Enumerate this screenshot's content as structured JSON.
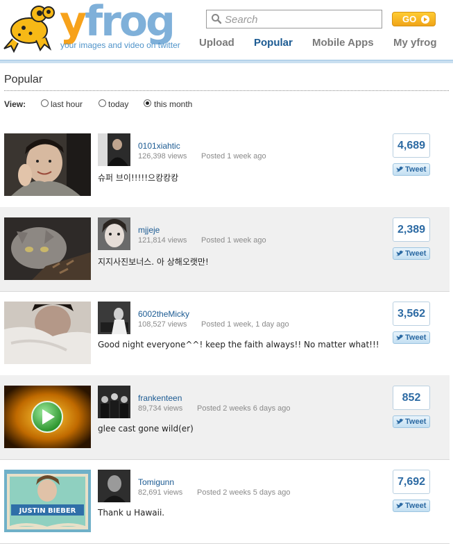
{
  "header": {
    "logo_part1": "y",
    "logo_part2": "frog",
    "tagline": "your images and video on twitter",
    "search_placeholder": "Search",
    "go_label": "GO",
    "nav": [
      {
        "label": "Upload",
        "active": false
      },
      {
        "label": "Popular",
        "active": true
      },
      {
        "label": "Mobile Apps",
        "active": false
      },
      {
        "label": "My yfrog",
        "active": false
      }
    ]
  },
  "section": {
    "title": "Popular",
    "view_label": "View:",
    "view_options": [
      {
        "label": "last hour",
        "selected": false
      },
      {
        "label": "today",
        "selected": false
      },
      {
        "label": "this month",
        "selected": true
      }
    ]
  },
  "items": [
    {
      "username": "0101xiahtic",
      "views": "126,398 views",
      "posted": "Posted 1 week ago",
      "caption": "슈퍼 브이!!!!!으캉캉캉",
      "count": "4,689",
      "tweet_label": "Tweet"
    },
    {
      "username": "mjjeje",
      "views": "121,814 views",
      "posted": "Posted 1 week ago",
      "caption": "지지사진보너스. 아 상해오랫만!",
      "count": "2,389",
      "tweet_label": "Tweet"
    },
    {
      "username": "6002theMicky",
      "views": "108,527 views",
      "posted": "Posted 1 week, 1 day ago",
      "caption": "Good night everyone^^! keep the faith always!! No matter what!!!",
      "count": "3,562",
      "tweet_label": "Tweet"
    },
    {
      "username": "frankenteen",
      "views": "89,734 views",
      "posted": "Posted 2 weeks 6 days ago",
      "caption": "glee cast gone wild(er)",
      "count": "852",
      "tweet_label": "Tweet"
    },
    {
      "username": "Tomigunn",
      "views": "82,691 views",
      "posted": "Posted 2 weeks 5 days ago",
      "caption": "Thank u Hawaii.",
      "count": "7,692",
      "tweet_label": "Tweet"
    }
  ],
  "thumb_texts": {
    "cake_text": "JUSTIN BIEBER"
  },
  "colors": {
    "brand_orange": "#f7a21b",
    "brand_blue": "#7fb0d9",
    "link_blue": "#1b5a92",
    "go_button": "#f0a418"
  }
}
